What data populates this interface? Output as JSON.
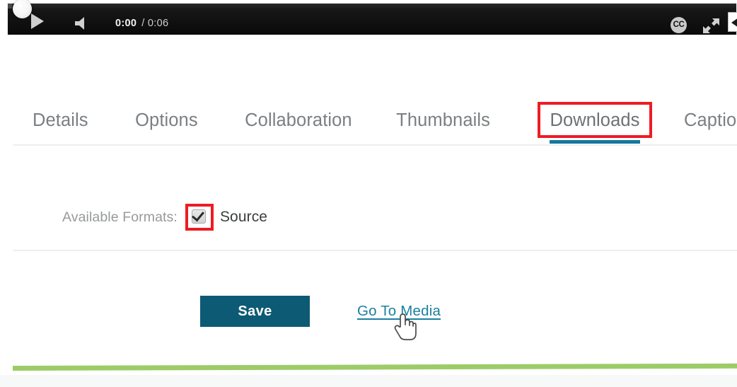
{
  "player": {
    "play_icon": "play-triangle-icon",
    "volume_icon": "volume-speaker-icon",
    "current_time": "0:00",
    "duration": "/ 0:06",
    "cc_label": "CC",
    "fullscreen_icon": "fullscreen-expand-icon",
    "scrubber_icon": "scrubber-handle-icon",
    "edge_icon": "edge-arrow-icon"
  },
  "tabs": [
    {
      "label": "Details",
      "active": false
    },
    {
      "label": "Options",
      "active": false
    },
    {
      "label": "Collaboration",
      "active": false
    },
    {
      "label": "Thumbnails",
      "active": false
    },
    {
      "label": "Downloads",
      "active": true
    },
    {
      "label": "Captio",
      "active": false
    }
  ],
  "formats": {
    "label": "Available Formats:",
    "checkbox_checked": true,
    "checkbox_name": "source-format-checkbox",
    "option_label": "Source"
  },
  "actions": {
    "save_label": "Save",
    "go_to_media_label": "Go To Media"
  },
  "colors": {
    "accent_teal": "#15789e",
    "save_button": "#0d5a74",
    "link": "#1b7f9e",
    "annotation_red": "#ed1c24",
    "green_bar": "#9ccc67",
    "tab_text": "#7b7f82"
  }
}
